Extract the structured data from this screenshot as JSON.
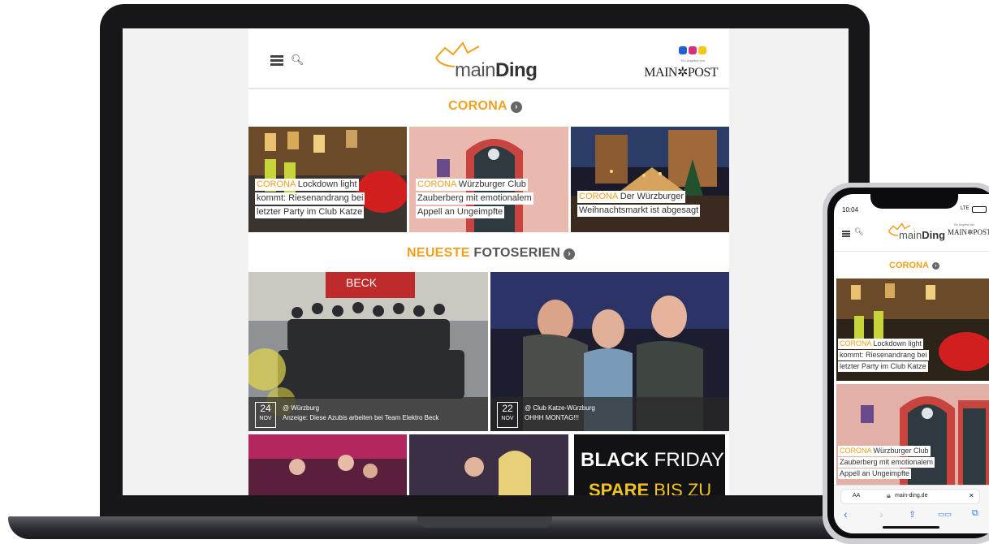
{
  "desktop_site": {
    "header": {
      "logo_light": "main",
      "logo_bold": "Ding",
      "offer_text": "Ein Angebot von",
      "publisher": "MAIN✲POST",
      "social_icons": [
        "facebook-icon",
        "instagram-icon",
        "snapchat-icon"
      ],
      "social_colors": [
        "#1e5fd8",
        "#d6307c",
        "#f5c518"
      ]
    },
    "corona_section": {
      "title": "CORONA",
      "articles": [
        {
          "tag": "CORONA",
          "line1": " Lockdown light",
          "line2": "kommt: Riesenandrang bei",
          "line3": "letzter Party im Club Katze"
        },
        {
          "tag": "CORONA",
          "line1": " Würzburger Club",
          "line2": "Zauberberg mit emotionalem",
          "line3": "Appell an Ungeimpfte"
        },
        {
          "tag": "CORONA",
          "line1": " Der Würzburger",
          "line2": "Weihnachtsmarkt ist abgesagt",
          "line3": ""
        }
      ]
    },
    "photo_section": {
      "title_accent": "NEUESTE",
      "title_rest": " FOTOSERIEN",
      "series": [
        {
          "day": "24",
          "month": "NOV",
          "location": "@ Würzburg",
          "title": "Anzeige: Diese Azubis arbeiten bei Team Elektro Beck",
          "sign": "BECK"
        },
        {
          "day": "22",
          "month": "NOV",
          "location": "@ Club Katze-Würzburg",
          "title": "OHHH MONTAG!!!"
        }
      ],
      "promo": {
        "line1_bold": "BLACK",
        "line1_thin": " FRIDAY",
        "line2_bold": "SPARE",
        "line2_thin": " BIS ZU"
      }
    }
  },
  "phone": {
    "time": "10:04",
    "network": "LTE",
    "logo_light": "main",
    "logo_bold": "Ding",
    "offer_text": "Ein Angebot der",
    "publisher": "MAIN✲POST",
    "corona_title": "CORONA",
    "articles": [
      {
        "tag": "CORONA",
        "line1": " Lockdown light",
        "line2": "kommt: Riesenandrang bei",
        "line3": "letzter Party im Club Katze"
      },
      {
        "tag": "CORONA",
        "line1": " Würzburger Club",
        "line2": "Zauberberg mit emotionalem",
        "line3": "Appell an Ungeimpfte"
      }
    ],
    "address_bar": {
      "text_size": "AA",
      "url": "main-ding.de",
      "close": "✕"
    },
    "toolbar": {
      "back": "‹",
      "forward": "›",
      "share": "⇪",
      "bookmarks": "▭▭",
      "tabs": "⧉"
    }
  },
  "colors": {
    "accent": "#f2a01e",
    "bezel": "#17171a"
  }
}
